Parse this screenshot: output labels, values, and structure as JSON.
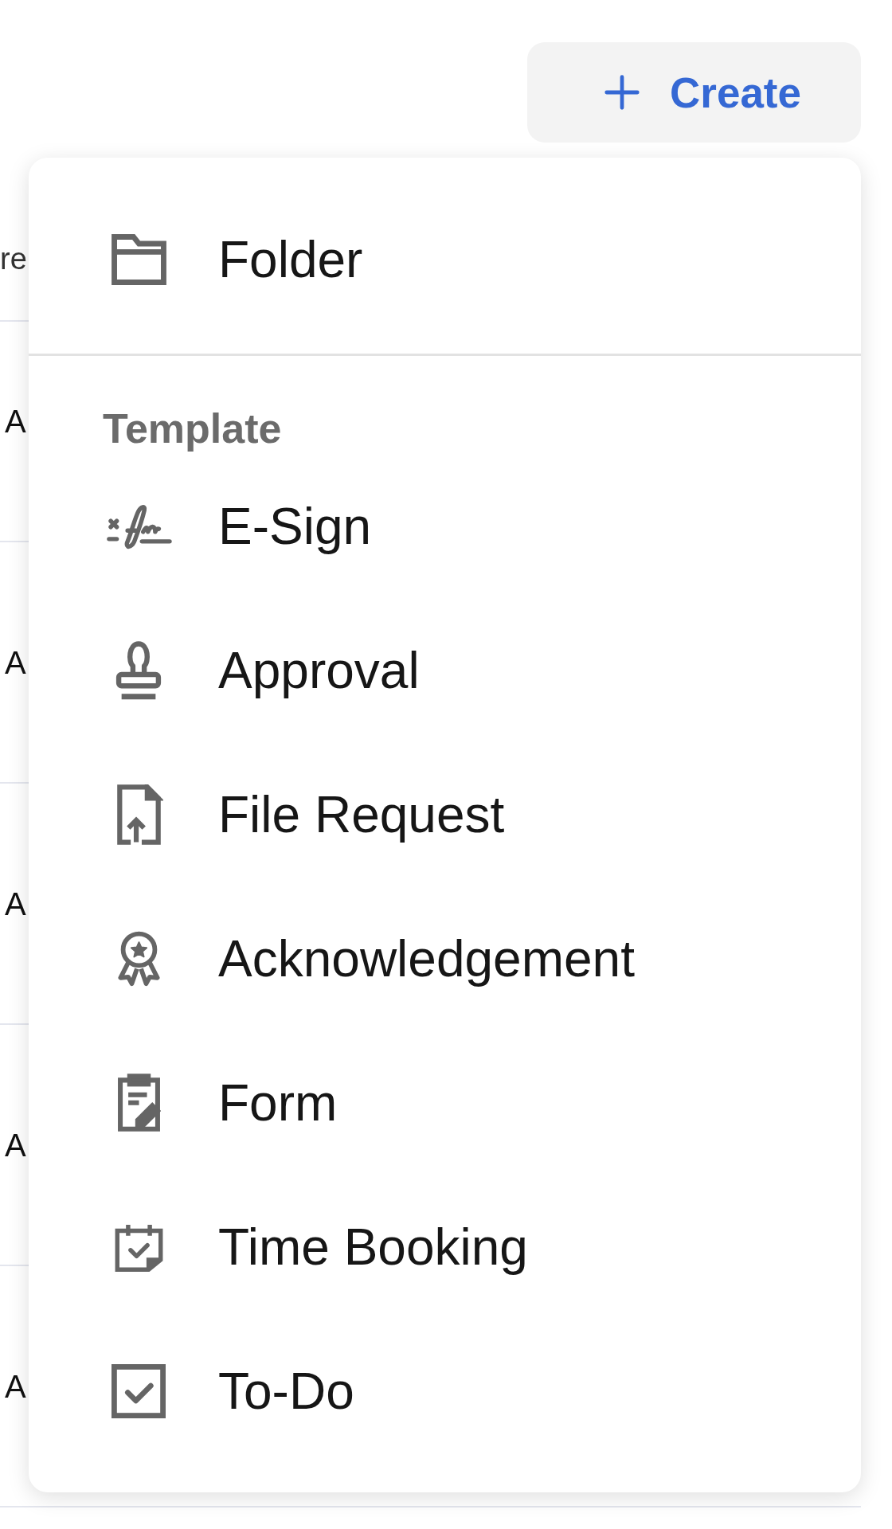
{
  "create_button": {
    "label": "Create"
  },
  "table": {
    "columns": [
      "re"
    ],
    "rows": [
      [
        "A"
      ],
      [
        "A"
      ],
      [
        "A"
      ],
      [
        "A"
      ],
      [
        "A"
      ]
    ]
  },
  "menu": {
    "items": [
      {
        "label": "Folder"
      }
    ],
    "sections": [
      {
        "title": "Template",
        "items": [
          {
            "label": "E-Sign"
          },
          {
            "label": "Approval"
          },
          {
            "label": "File Request"
          },
          {
            "label": "Acknowledgement"
          },
          {
            "label": "Form"
          },
          {
            "label": "Time Booking"
          },
          {
            "label": "To-Do"
          }
        ]
      }
    ]
  }
}
